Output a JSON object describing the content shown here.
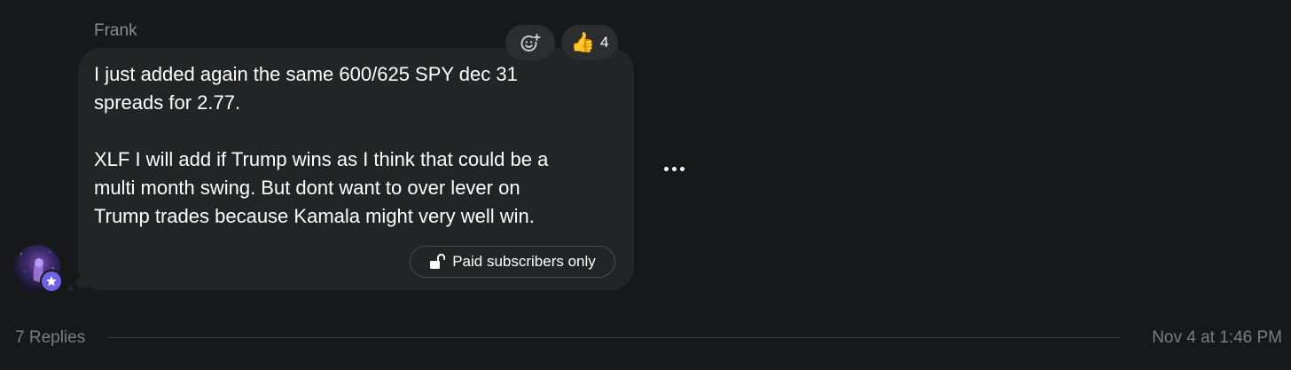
{
  "comment": {
    "author": "Frank",
    "message_lines": [
      "I just added again the same 600/625 SPY dec 31",
      "spreads for 2.77.",
      "XLF I will add if Trump wins as I think that could be a",
      "multi month swing. But dont want to over lever on",
      "Trump trades because Kamala might very well win."
    ],
    "reaction": {
      "emoji": "👍",
      "count": "4"
    },
    "add_reaction_icon": "add-emoji-icon",
    "more_icon": "more-dots-icon",
    "paid_label": "Paid subscribers only",
    "paid_icon": "unlock-icon",
    "badge_icon": "star-icon",
    "badge_color": "#6e63e6"
  },
  "footer": {
    "replies_label": "7 Replies",
    "timestamp": "Nov 4 at 1:46 PM"
  }
}
